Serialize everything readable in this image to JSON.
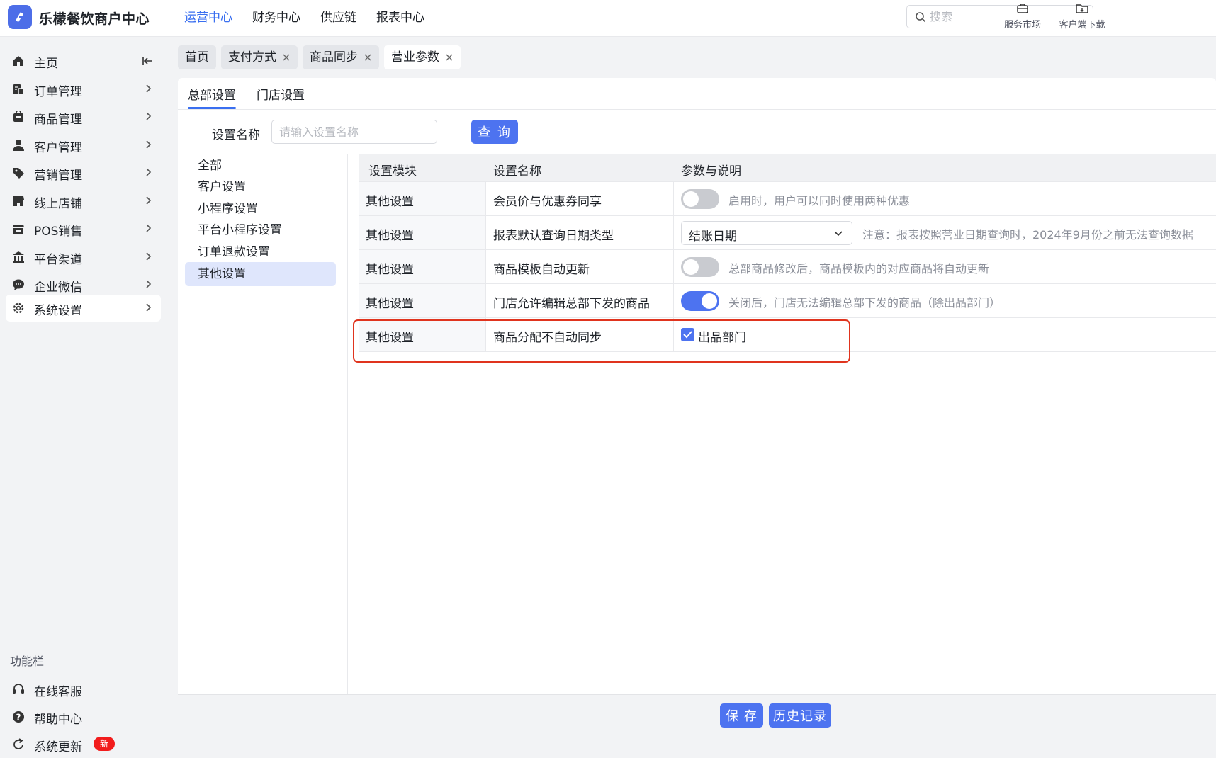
{
  "app": {
    "title": "乐檬餐饮商户中心"
  },
  "topnav": [
    {
      "label": "运营中心",
      "active": true
    },
    {
      "label": "财务中心"
    },
    {
      "label": "供应链"
    },
    {
      "label": "报表中心"
    }
  ],
  "search": {
    "placeholder": "搜索"
  },
  "tools": {
    "market": "服务市场",
    "download": "客户端下载"
  },
  "sidebar": {
    "items": [
      {
        "label": "主页",
        "icon": "home-icon"
      },
      {
        "label": "订单管理",
        "icon": "order-icon"
      },
      {
        "label": "商品管理",
        "icon": "goods-icon"
      },
      {
        "label": "客户管理",
        "icon": "user-icon"
      },
      {
        "label": "营销管理",
        "icon": "tag-icon"
      },
      {
        "label": "线上店铺",
        "icon": "store-icon"
      },
      {
        "label": "POS销售",
        "icon": "pos-icon"
      },
      {
        "label": "平台渠道",
        "icon": "bank-icon"
      },
      {
        "label": "企业微信",
        "icon": "chat-icon"
      },
      {
        "label": "系统设置",
        "icon": "gear-icon",
        "active": true
      }
    ],
    "section_title": "功能栏",
    "tools": [
      {
        "label": "在线客服",
        "icon": "headset-icon"
      },
      {
        "label": "帮助中心",
        "icon": "help-icon"
      },
      {
        "label": "系统更新",
        "icon": "refresh-icon",
        "badge": "新"
      }
    ]
  },
  "tabs": [
    {
      "label": "首页",
      "closable": false
    },
    {
      "label": "支付方式",
      "closable": true
    },
    {
      "label": "商品同步",
      "closable": true
    },
    {
      "label": "营业参数",
      "closable": true,
      "active": true
    }
  ],
  "subtabs": [
    {
      "label": "总部设置",
      "active": true
    },
    {
      "label": "门店设置"
    }
  ],
  "filter": {
    "label": "设置名称",
    "placeholder": "请输入设置名称",
    "button": "查 询"
  },
  "categories": [
    {
      "label": "全部"
    },
    {
      "label": "客户设置"
    },
    {
      "label": "小程序设置"
    },
    {
      "label": "平台小程序设置"
    },
    {
      "label": "订单退款设置"
    },
    {
      "label": "其他设置",
      "active": true
    }
  ],
  "table": {
    "headers": [
      "设置模块",
      "设置名称",
      "参数与说明"
    ],
    "rows": [
      {
        "module": "其他设置",
        "name": "会员价与优惠券同享",
        "type": "toggle",
        "on": false,
        "desc": "启用时，用户可以同时使用两种优惠"
      },
      {
        "module": "其他设置",
        "name": "报表默认查询日期类型",
        "type": "select",
        "value": "结账日期",
        "desc": "注意：报表按照营业日期查询时，2024年9月份之前无法查询数据"
      },
      {
        "module": "其他设置",
        "name": "商品模板自动更新",
        "type": "toggle",
        "on": false,
        "desc": "总部商品修改后，商品模板内的对应商品将自动更新"
      },
      {
        "module": "其他设置",
        "name": "门店允许编辑总部下发的商品",
        "type": "toggle",
        "on": true,
        "desc": "关闭后，门店无法编辑总部下发的商品（除出品部门）"
      },
      {
        "module": "其他设置",
        "name": "商品分配不自动同步",
        "type": "checkbox",
        "checked": true,
        "desc": "出品部门"
      }
    ]
  },
  "footer": {
    "save": "保 存",
    "history": "历史记录"
  },
  "colors": {
    "accent": "#4d73f0",
    "highlight": "#e0341e",
    "badge": "#f21c1c"
  }
}
